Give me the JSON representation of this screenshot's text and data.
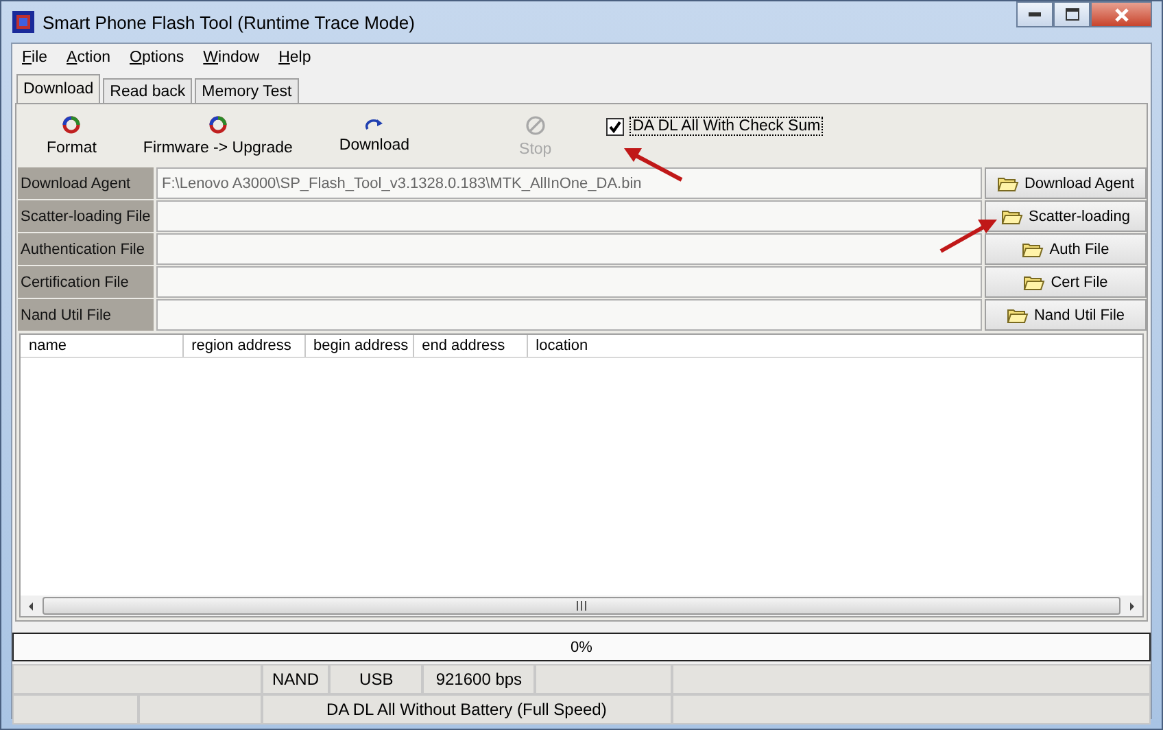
{
  "window": {
    "title": "Smart Phone Flash Tool (Runtime Trace Mode)"
  },
  "menu": [
    "File",
    "Action",
    "Options",
    "Window",
    "Help"
  ],
  "tabs": [
    {
      "label": "Download",
      "selected": true
    },
    {
      "label": "Read back",
      "selected": false
    },
    {
      "label": "Memory Test",
      "selected": false
    }
  ],
  "toolbar": [
    {
      "kind": "format",
      "label": "Format",
      "disabled": false
    },
    {
      "kind": "firmware",
      "label": "Firmware -> Upgrade",
      "disabled": false
    },
    {
      "kind": "download",
      "label": "Download",
      "disabled": false
    },
    {
      "kind": "stop",
      "label": "Stop",
      "disabled": true
    }
  ],
  "checksum_option": {
    "label": "DA DL All With Check Sum",
    "checked": true
  },
  "files": [
    {
      "label": "Download Agent",
      "value": "F:\\Lenovo A3000\\SP_Flash_Tool_v3.1328.0.183\\MTK_AllInOne_DA.bin",
      "button": "Download Agent"
    },
    {
      "label": "Scatter-loading File",
      "button": "Scatter-loading"
    },
    {
      "label": "Authentication File",
      "button": "Auth File"
    },
    {
      "label": "Certification File",
      "button": "Cert File"
    },
    {
      "label": "Nand Util File",
      "button": "Nand Util File"
    }
  ],
  "table": {
    "columns": [
      "name",
      "region address",
      "begin address",
      "end address",
      "location"
    ]
  },
  "progress": {
    "text": "0%",
    "level": 0
  },
  "status_bar": {
    "row_1": [
      "NAND",
      "USB",
      "921600 bps"
    ],
    "row_2": [
      "DA DL All Without Battery (Full Speed)"
    ]
  }
}
